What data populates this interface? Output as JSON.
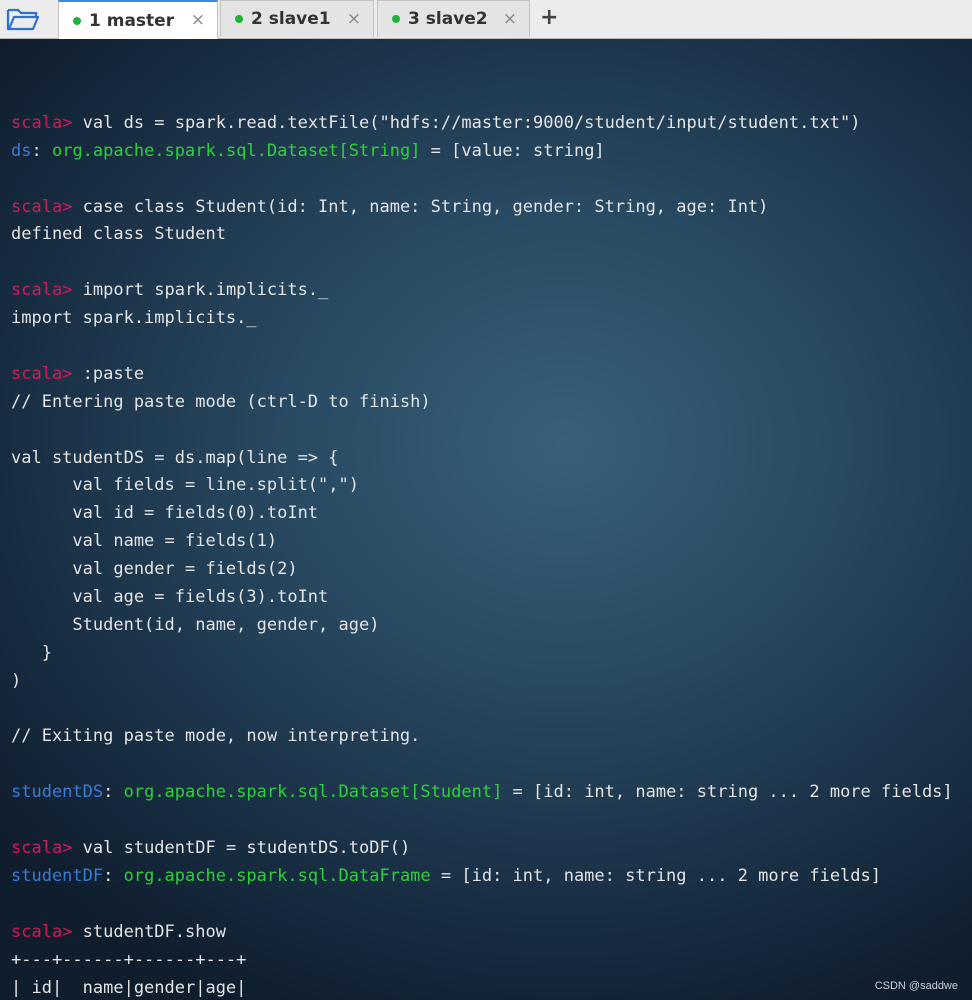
{
  "tabs": [
    {
      "label": "1 master",
      "dot_color": "#1fb33a",
      "active": true
    },
    {
      "label": "2 slave1",
      "dot_color": "#1fb33a",
      "active": false
    },
    {
      "label": "3 slave2",
      "dot_color": "#1fb33a",
      "active": false
    }
  ],
  "tab_icons": {
    "close": "×",
    "new_tab": "+",
    "open": "folder-open-icon"
  },
  "terminal": {
    "lines": [
      [],
      [
        [
          "p",
          "scala>"
        ],
        [
          "t",
          " val ds = spark.read.textFile(\"hdfs://master:9000/student/input/student.txt\")"
        ]
      ],
      [
        [
          "b",
          "ds"
        ],
        [
          "t",
          ": "
        ],
        [
          "g",
          "org.apache.spark.sql.Dataset[String]"
        ],
        [
          "t",
          " = [value: string]"
        ]
      ],
      [],
      [
        [
          "p",
          "scala>"
        ],
        [
          "t",
          " case class Student(id: Int, name: String, gender: String, age: Int)"
        ]
      ],
      [
        [
          "t",
          "defined class Student"
        ]
      ],
      [],
      [
        [
          "p",
          "scala>"
        ],
        [
          "t",
          " import spark.implicits._"
        ]
      ],
      [
        [
          "t",
          "import spark.implicits._"
        ]
      ],
      [],
      [
        [
          "p",
          "scala>"
        ],
        [
          "t",
          " :paste"
        ]
      ],
      [
        [
          "t",
          "// Entering paste mode (ctrl-D to finish)"
        ]
      ],
      [],
      [
        [
          "t",
          "val studentDS = ds.map(line => {"
        ]
      ],
      [
        [
          "t",
          "      val fields = line.split(\",\")"
        ]
      ],
      [
        [
          "t",
          "      val id = fields(0).toInt"
        ]
      ],
      [
        [
          "t",
          "      val name = fields(1)"
        ]
      ],
      [
        [
          "t",
          "      val gender = fields(2)"
        ]
      ],
      [
        [
          "t",
          "      val age = fields(3).toInt"
        ]
      ],
      [
        [
          "t",
          "      Student(id, name, gender, age)"
        ]
      ],
      [
        [
          "t",
          "   }"
        ]
      ],
      [
        [
          "t",
          ")"
        ]
      ],
      [],
      [
        [
          "t",
          "// Exiting paste mode, now interpreting."
        ]
      ],
      [],
      [
        [
          "b",
          "studentDS"
        ],
        [
          "t",
          ": "
        ],
        [
          "g",
          "org.apache.spark.sql.Dataset[Student]"
        ],
        [
          "t",
          " = [id: int, name: string ... 2 more fields]"
        ]
      ],
      [],
      [
        [
          "p",
          "scala>"
        ],
        [
          "t",
          " val studentDF = studentDS.toDF()"
        ]
      ],
      [
        [
          "b",
          "studentDF"
        ],
        [
          "t",
          ": "
        ],
        [
          "g",
          "org.apache.spark.sql.DataFrame"
        ],
        [
          "t",
          " = [id: int, name: string ... 2 more fields]"
        ]
      ],
      [],
      [
        [
          "p",
          "scala>"
        ],
        [
          "t",
          " studentDF.show"
        ]
      ],
      [
        [
          "t",
          "+---+------+------+---+"
        ]
      ],
      [
        [
          "t",
          "| id|  name|gender|age|"
        ]
      ],
      [
        [
          "t",
          "+---+------+------+---+"
        ]
      ]
    ]
  },
  "watermark": "CSDN @saddwe"
}
